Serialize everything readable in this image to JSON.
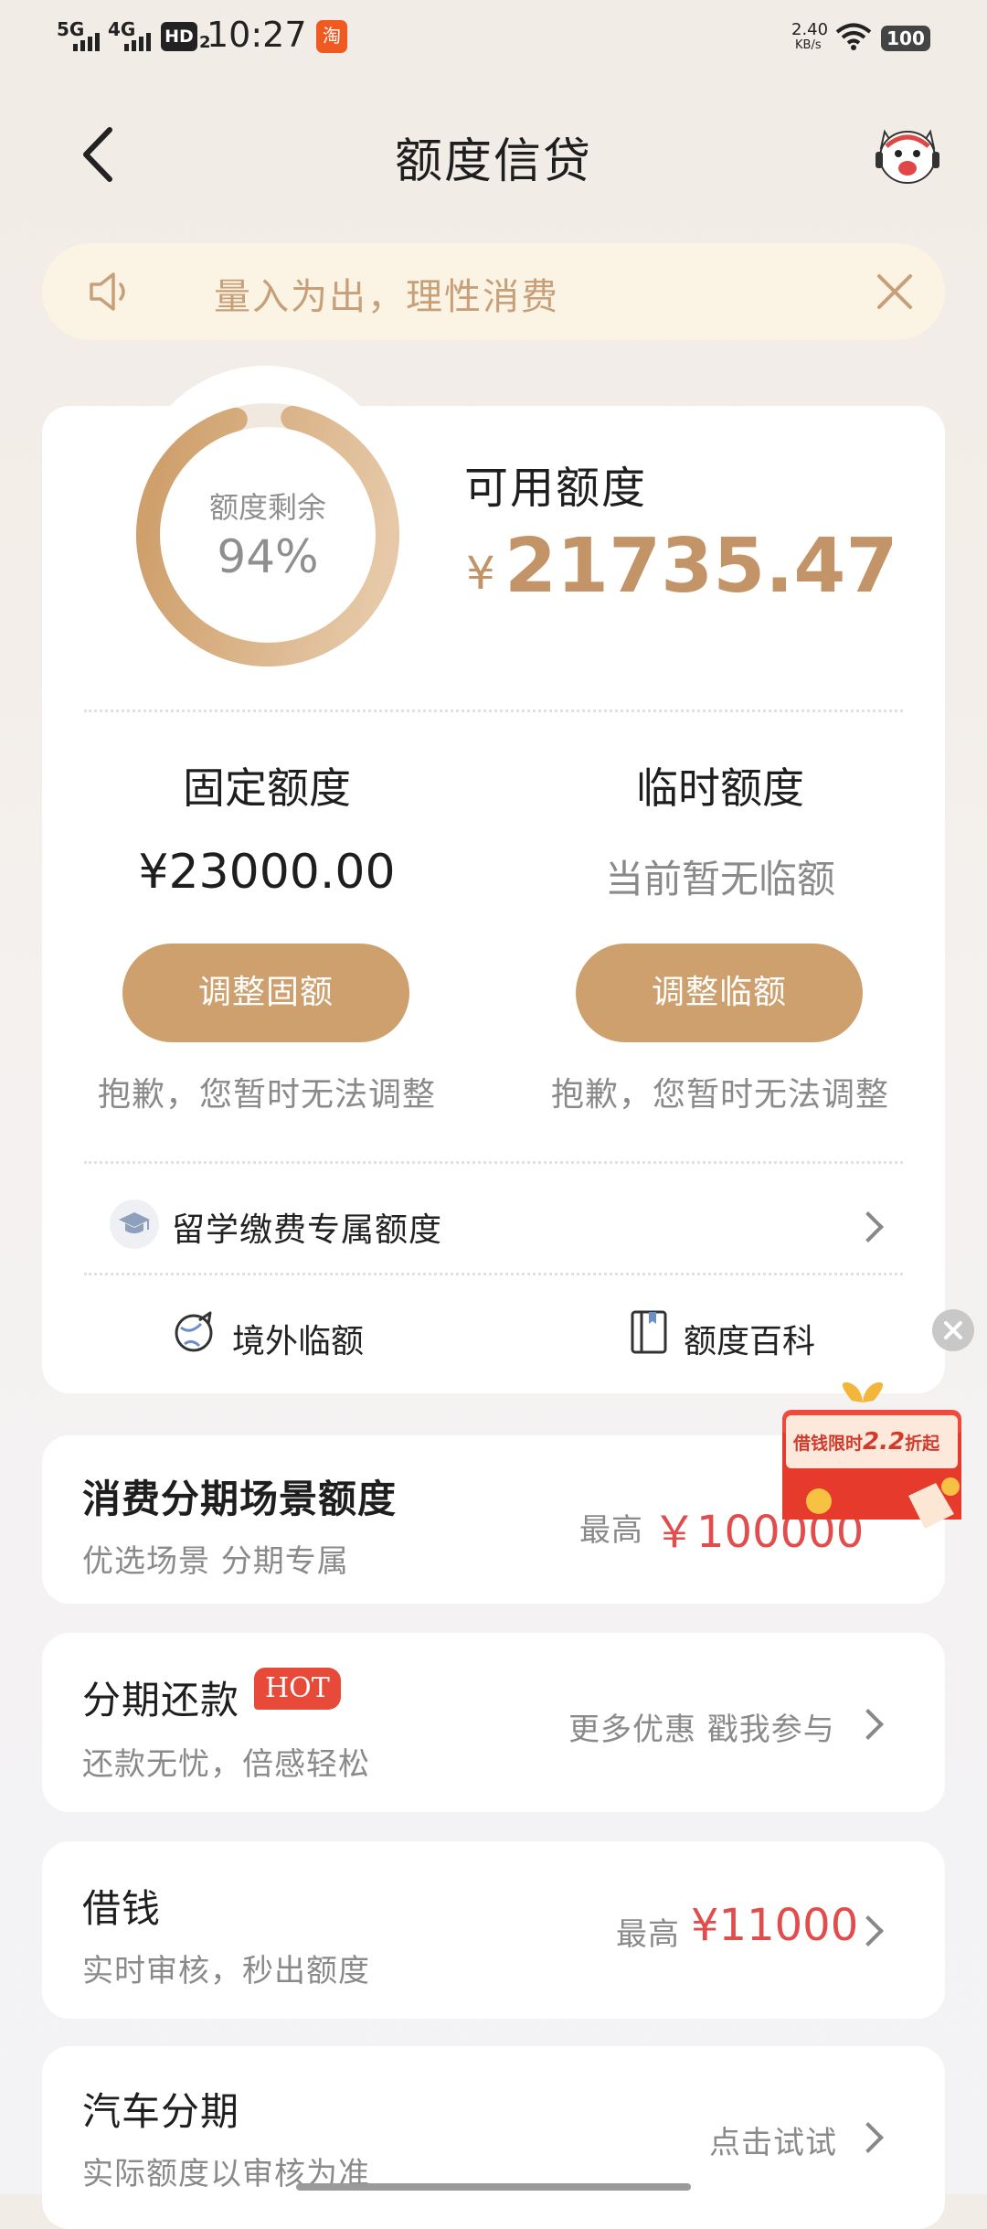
{
  "status_bar": {
    "signal_1": "5G",
    "signal_2": "4G",
    "hd": "HD",
    "hd_sub": "2",
    "time": "10:27",
    "app_badge": "淘",
    "speed_value": "2.40",
    "speed_unit": "KB/s",
    "battery": "100"
  },
  "header": {
    "back_icon": "back-arrow-icon",
    "title": "额度信贷",
    "avatar_icon": "assistant-mascot-icon"
  },
  "notice": {
    "speaker_icon": "speaker-icon",
    "text": "量入为出，理性消费",
    "close_icon": "close-icon"
  },
  "credit": {
    "ring_label": "额度剩余",
    "ring_percent_text": "94%",
    "ring_fraction": 0.94,
    "available_label": "可用额度",
    "currency": "¥",
    "available_amount": "21735.47",
    "fixed_label": "固定额度",
    "fixed_amount": "¥23000.00",
    "temp_label": "临时额度",
    "temp_status": "当前暂无临额",
    "adjust_fixed_label": "调整固额",
    "adjust_temp_label": "调整临额",
    "fixed_sorry": "抱歉，您暂时无法调整",
    "temp_sorry": "抱歉，您暂时无法调整",
    "study_abroad_label": "留学缴费专属额度",
    "overseas_label": "境外临额",
    "encyclopedia_label": "额度百科"
  },
  "floating_promo": {
    "text_prefix": "借钱限时",
    "text_value": "2.2",
    "text_suffix": "折起",
    "close_icon": "close-icon"
  },
  "rows": {
    "consumer": {
      "title": "消费分期场景额度",
      "subtitle": "优选场景 分期专属",
      "right_prefix": "最高",
      "right_amount": "￥100000"
    },
    "installment": {
      "title": "分期还款",
      "badge": "HOT",
      "subtitle": "还款无忧，倍感轻松",
      "right_text": "更多优惠 戳我参与"
    },
    "borrow": {
      "title": "借钱",
      "subtitle": "实时审核，秒出额度",
      "right_prefix": "最高",
      "right_amount": "¥11000"
    },
    "car": {
      "title": "汽车分期",
      "subtitle": "实际额度以审核为准",
      "right_text": "点击试试"
    }
  },
  "colors": {
    "gold": "#cda06e",
    "gold_text": "#c39467",
    "red": "#e14c4c",
    "notice_bg": "#fbf3e3"
  }
}
